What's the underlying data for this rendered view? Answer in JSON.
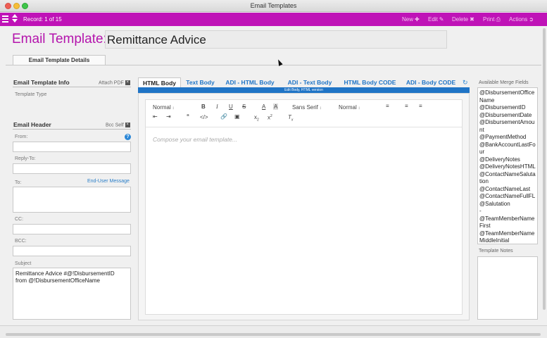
{
  "window": {
    "title": "Email Templates"
  },
  "toolbar": {
    "record": "Record: 1 of 15",
    "actions": [
      {
        "label": "New",
        "icon": "plus-icon"
      },
      {
        "label": "Edit",
        "icon": "pencil-icon"
      },
      {
        "label": "Delete",
        "icon": "delete-x-icon"
      },
      {
        "label": "Print",
        "icon": "printer-icon"
      },
      {
        "label": "Actions",
        "icon": "actions-icon"
      }
    ]
  },
  "header": {
    "label": "Email Template:",
    "name": "Remittance Advice"
  },
  "section_tab": "Email Template Details",
  "left": {
    "info_title": "Email Template Info",
    "attach_pdf": "Attach PDF",
    "template_type": "Template Type",
    "header_title": "Email Header",
    "bcc_self": "Bcc Self",
    "from": "From:",
    "reply_to": "Reply-To:",
    "to": "To:",
    "end_user_message": "End-User Message",
    "cc": "CC:",
    "bcc": "BCC:",
    "subject_label": "Subject",
    "subject_value": "Remittance Advice #@!DisbursementID\nfrom @!DisbursementOfficeName"
  },
  "tabs": [
    {
      "label": "HTML Body",
      "active": true
    },
    {
      "label": "Text Body",
      "active": false
    },
    {
      "label": "ADI - HTML Body",
      "active": false
    },
    {
      "label": "ADI - Text Body",
      "active": false
    },
    {
      "label": "HTML Body CODE",
      "active": false
    },
    {
      "label": "ADI - Body CODE",
      "active": false
    }
  ],
  "tab_strip": "Edit Body, HTML version",
  "editor": {
    "format": "Normal",
    "font": "Sans Serif",
    "size": "Normal",
    "placeholder": "Compose your email template..."
  },
  "merge_fields": {
    "title": "Available Merge Fields",
    "items": [
      "@DisbursementOfficeName",
      "@DisbursementID",
      "@DisbursementDate",
      "@DisbursementAmount",
      "@PaymentMethod",
      "@BankAccountLastFour",
      "@DeliveryNotes",
      "@DeliveryNotesHTML",
      "@ContactNameSalutation",
      "@ContactNameLast",
      "@ContactNameFullFL",
      "@Salutation",
      "-",
      "@TeamMemberNameFirst",
      "@TeamMemberNameMiddleInitial"
    ]
  },
  "notes_title": "Template Notes",
  "colors": {
    "accent": "#bf13b7",
    "link": "#1f74c6"
  }
}
